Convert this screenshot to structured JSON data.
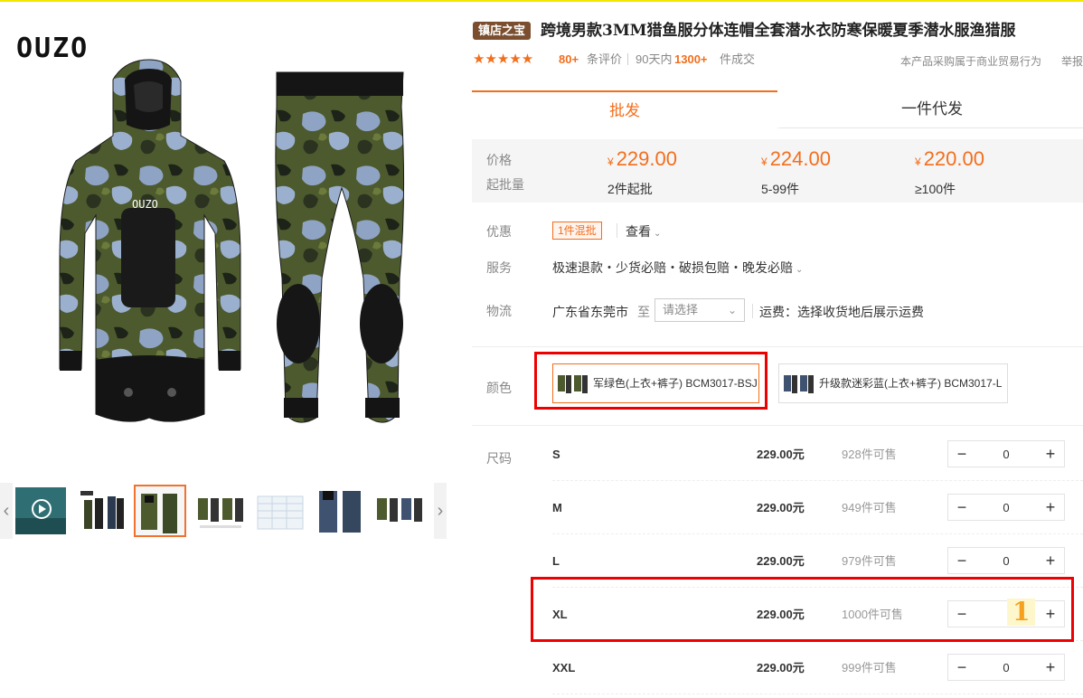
{
  "brand": {
    "logo_text": "OUZO",
    "chest_logo": "OUZO"
  },
  "title": {
    "badge": "镇店之宝",
    "text": "跨境男款3MM猎鱼服分体连帽全套潜水衣防寒保暖夏季潜水服渔猎服"
  },
  "rating": {
    "stars": "★★★★★",
    "review_count": "80+",
    "review_label": "条评价",
    "days_label": "90天内",
    "deal_count": "1300+",
    "deal_label": "件成交",
    "business_note": "本产品采购属于商业贸易行为",
    "report_label": "举报"
  },
  "tabs": [
    {
      "label": "批发",
      "active": true
    },
    {
      "label": "一件代发",
      "active": false
    }
  ],
  "price_box": {
    "price_label": "价格",
    "moq_label": "起批量",
    "currency": "¥",
    "tiers": [
      {
        "price": "229.00",
        "qty": "2件起批"
      },
      {
        "price": "224.00",
        "qty": "5-99件"
      },
      {
        "price": "220.00",
        "qty": "≥100件"
      }
    ]
  },
  "promo": {
    "label": "优惠",
    "tag": "1件混批",
    "view_label": "查看"
  },
  "service": {
    "label": "服务",
    "text": "极速退款・少货必赔・破损包赔・晚发必赔"
  },
  "logistics": {
    "label": "物流",
    "from": "广东省东莞市",
    "to_word": "至",
    "select_placeholder": "请选择",
    "freight": "运费：选择收货地后展示运费"
  },
  "color": {
    "label": "颜色",
    "options": [
      {
        "label": "军绿色(上衣+裤子) BCM3017-BSJ",
        "selected": true
      },
      {
        "label": "升级款迷彩蓝(上衣+裤子) BCM3017-L",
        "selected": false
      }
    ]
  },
  "size": {
    "label": "尺码",
    "unit": "元",
    "rows": [
      {
        "name": "S",
        "price": "229.00元",
        "stock": "928件可售",
        "qty": "0"
      },
      {
        "name": "M",
        "price": "229.00元",
        "stock": "949件可售",
        "qty": "0"
      },
      {
        "name": "L",
        "price": "229.00元",
        "stock": "979件可售",
        "qty": "0"
      },
      {
        "name": "XL",
        "price": "229.00元",
        "stock": "1000件可售",
        "qty": ""
      },
      {
        "name": "XXL",
        "price": "229.00元",
        "stock": "999件可售",
        "qty": "0"
      }
    ]
  },
  "annotation": {
    "text": "1"
  },
  "stepper": {
    "minus": "−",
    "plus": "+"
  },
  "arrows": {
    "prev": "‹",
    "next": "›",
    "chevron": "⌄"
  },
  "colors": {
    "accent": "#f36e1c",
    "highlight": "#e00000",
    "badge": "#7a4e2e",
    "camo_green": "#4d5a2e",
    "camo_blue": "#8fa4c4"
  }
}
